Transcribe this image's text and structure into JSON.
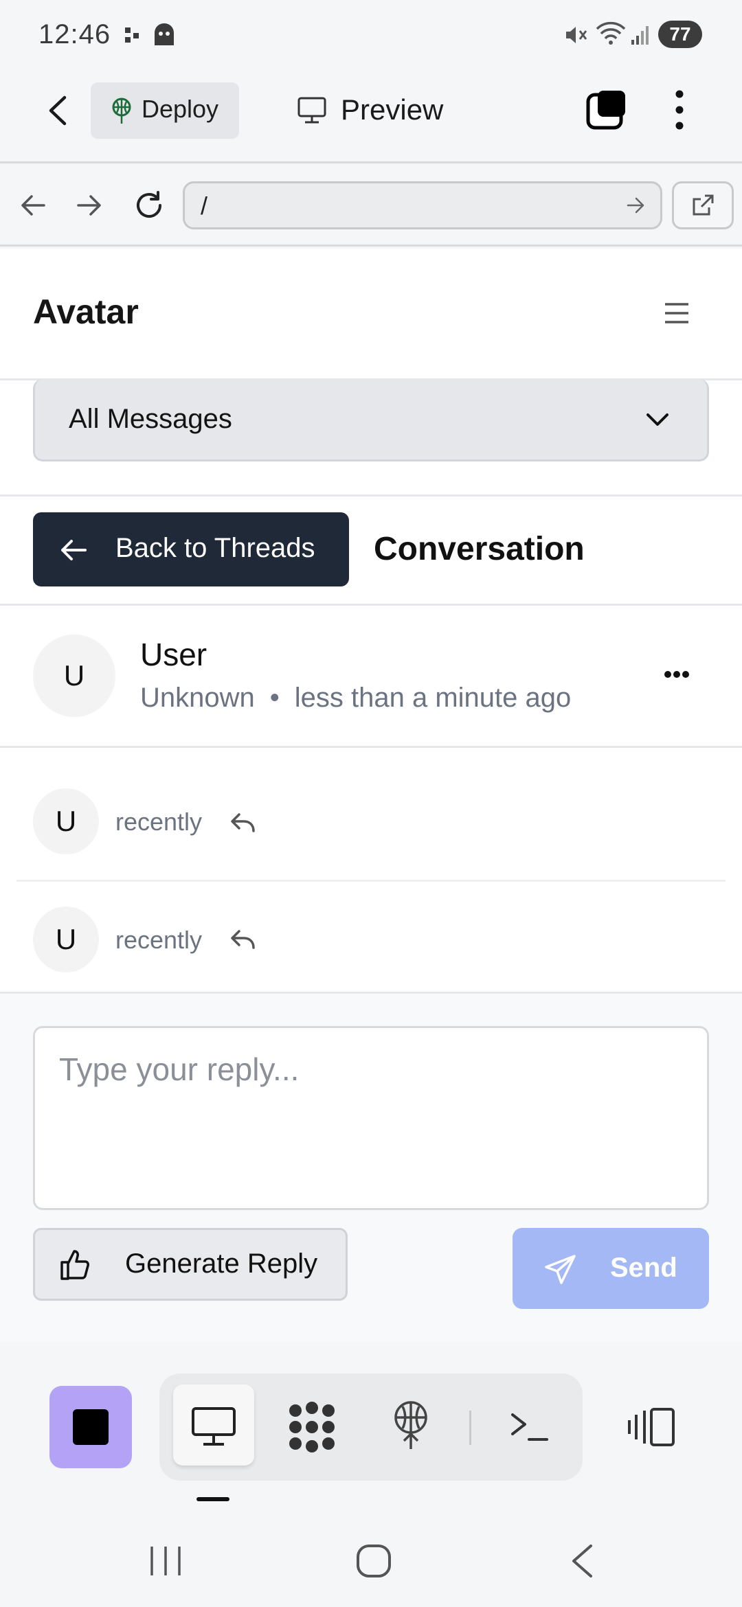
{
  "status_bar": {
    "time": "12:46",
    "battery": "77"
  },
  "app_bar": {
    "deploy_label": "Deploy",
    "preview_label": "Preview"
  },
  "browser": {
    "url": "/"
  },
  "page": {
    "title": "Avatar",
    "filter": {
      "selected": "All Messages"
    },
    "back_label": "Back to Threads",
    "conversation_title": "Conversation",
    "thread_header": {
      "avatar_initial": "U",
      "name": "User",
      "source": "Unknown",
      "separator": "•",
      "time": "less than a minute ago"
    },
    "messages": [
      {
        "avatar_initial": "U",
        "time": "recently"
      },
      {
        "avatar_initial": "U",
        "time": "recently"
      }
    ],
    "reply": {
      "placeholder": "Type your reply...",
      "generate_label": "Generate Reply",
      "send_label": "Send"
    }
  },
  "colors": {
    "primary_dark": "#1f2937",
    "send_disabled": "#a3b8f5",
    "stop_accent": "#b4a2f7"
  }
}
